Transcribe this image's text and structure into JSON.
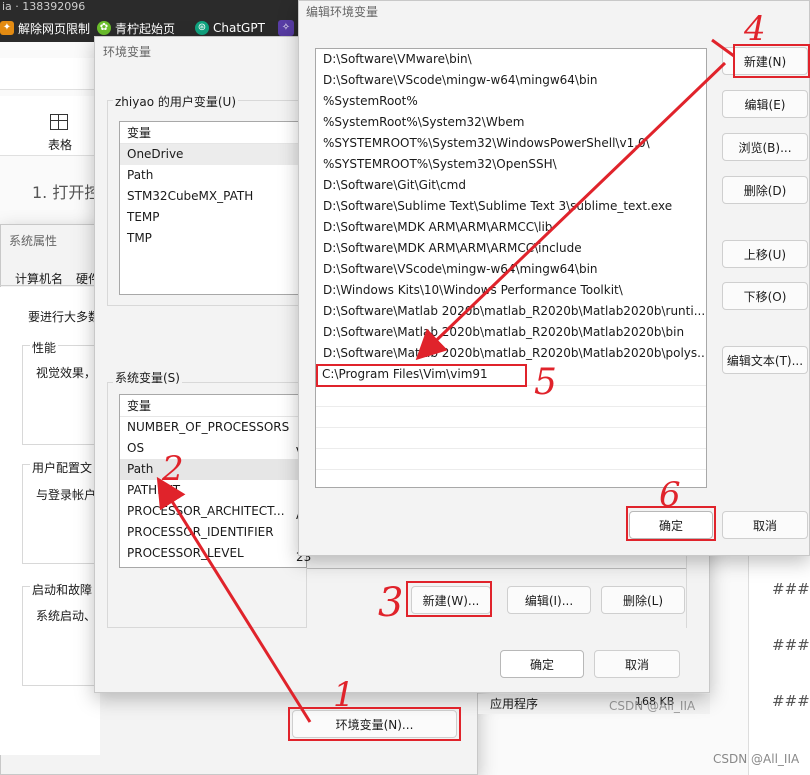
{
  "browser": {
    "tab_partial": "ia · 138392096",
    "bookmarks": [
      "解除网页限制",
      "青柠起始页",
      "ChatGPT"
    ],
    "toolbar_table_label": "表格",
    "step_text": "1. 打开控"
  },
  "sysprop": {
    "title": "系统属性",
    "tabs": [
      "计算机名",
      "硬件"
    ],
    "intro": "要进行大多数",
    "perf_label": "性能",
    "perf_text": "视觉效果，",
    "profile_label": "用户配置文",
    "profile_text": "与登录帐户",
    "startup_label": "启动和故障",
    "startup_text": "系统启动、",
    "envvar_button": "环境变量(N)..."
  },
  "envvars": {
    "title": "环境变量",
    "user_group": "zhiyao 的用户变量(U)",
    "user_header": "变量",
    "user_vars": [
      "OneDrive",
      "Path",
      "STM32CubeMX_PATH",
      "TEMP",
      "TMP"
    ],
    "sys_group": "系统变量(S)",
    "sys_header": "变量",
    "sys_vars": [
      "NUMBER_OF_PROCESSORS",
      "OS",
      "Path",
      "PATHEXT",
      "PROCESSOR_ARCHITECT...",
      "PROCESSOR_IDENTIFIER",
      "PROCESSOR_LEVEL"
    ],
    "sys_vals": [
      "",
      "V",
      "",
      "",
      "A",
      "",
      "23"
    ],
    "btn_new": "新建(W)...",
    "btn_edit": "编辑(I)...",
    "btn_delete": "删除(L)",
    "btn_ok": "确定",
    "btn_cancel": "取消"
  },
  "editenv": {
    "title": "编辑环境变量",
    "paths": [
      "D:\\Software\\VMware\\bin\\",
      "D:\\Software\\VScode\\mingw-w64\\mingw64\\bin",
      "%SystemRoot%",
      "%SystemRoot%\\System32\\Wbem",
      "%SYSTEMROOT%\\System32\\WindowsPowerShell\\v1.0\\",
      "%SYSTEMROOT%\\System32\\OpenSSH\\",
      "D:\\Software\\Git\\Git\\cmd",
      "D:\\Software\\Sublime Text\\Sublime Text 3\\sublime_text.exe",
      "D:\\Software\\MDK ARM\\ARM\\ARMCC\\lib",
      "D:\\Software\\MDK ARM\\ARM\\ARMCC\\include",
      "D:\\Software\\VScode\\mingw-w64\\mingw64\\bin",
      "D:\\Windows Kits\\10\\Windows Performance Toolkit\\",
      "D:\\Software\\Matlab 2020b\\matlab_R2020b\\Matlab2020b\\runti...",
      "D:\\Software\\Matlab 2020b\\matlab_R2020b\\Matlab2020b\\bin",
      "D:\\Software\\Matlab 2020b\\matlab_R2020b\\Matlab2020b\\polys..."
    ],
    "editing_value": "C:\\Program Files\\Vim\\vim91",
    "btn_new": "新建(N)",
    "btn_edit": "编辑(E)",
    "btn_browse": "浏览(B)...",
    "btn_delete": "删除(D)",
    "btn_up": "上移(U)",
    "btn_down": "下移(O)",
    "btn_edit_text": "编辑文本(T)...",
    "btn_ok": "确定",
    "btn_cancel": "取消"
  },
  "background_right": {
    "md_headers": [
      "###",
      "###",
      "###"
    ],
    "app_label": "应用程序",
    "size": "168 KB",
    "csdn_mid": "CSDN @All_IIA",
    "csdn_corner": "CSDN @All_IIA"
  },
  "annotations": {
    "numbers": [
      "1",
      "2",
      "3",
      "4",
      "5",
      "6"
    ],
    "color": "#e0232b"
  }
}
